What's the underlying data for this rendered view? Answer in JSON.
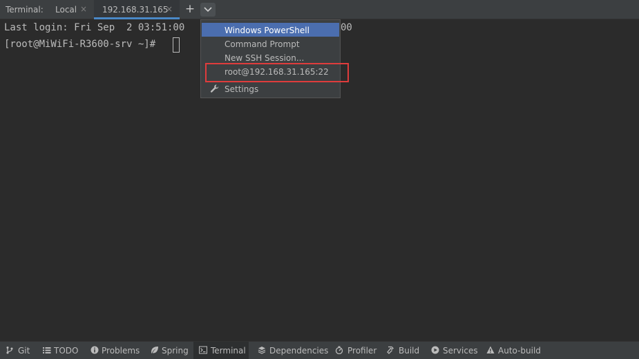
{
  "header": {
    "title": "Terminal:",
    "tabs": [
      {
        "label": "Local",
        "close": "×"
      },
      {
        "label": "192.168.31.165",
        "close": "×"
      }
    ],
    "new_tab": "+",
    "accent": "#4a88c7"
  },
  "terminal": {
    "lines": [
      "Last login: Fri Sep  2 03:51:00",
      "[root@MiWiFi-R3600-srv ~]# "
    ],
    "trailing_text": "00"
  },
  "dropdown": {
    "items": [
      {
        "label": "Windows PowerShell",
        "selected": true
      },
      {
        "label": "Command Prompt"
      },
      {
        "label": "New SSH Session..."
      },
      {
        "label": "root@192.168.31.165:22",
        "highlighted": true
      },
      {
        "label": "Settings",
        "icon": "wrench-icon"
      }
    ],
    "selection_color": "#4b6eaf",
    "highlight_color": "#e03c3c"
  },
  "bottom_bar": {
    "tabs": [
      {
        "label": "Git",
        "icon": "branch-icon"
      },
      {
        "label": "TODO",
        "icon": "list-icon"
      },
      {
        "label": "Problems",
        "icon": "info-icon"
      },
      {
        "label": "Spring",
        "icon": "leaf-icon"
      },
      {
        "label": "Terminal",
        "icon": "terminal-icon",
        "active": true
      },
      {
        "label": "Dependencies",
        "icon": "layers-icon"
      },
      {
        "label": "Profiler",
        "icon": "profiler-icon"
      },
      {
        "label": "Build",
        "icon": "hammer-icon"
      },
      {
        "label": "Services",
        "icon": "services-icon"
      },
      {
        "label": "Auto-build",
        "icon": "warning-icon"
      }
    ]
  }
}
